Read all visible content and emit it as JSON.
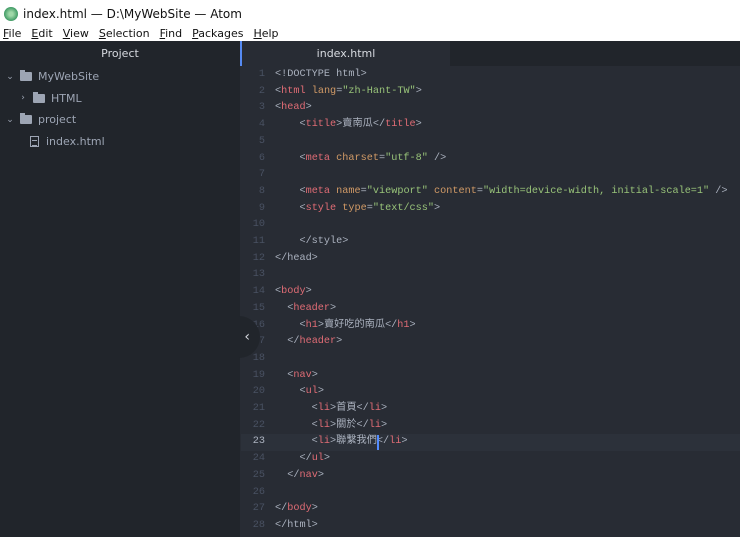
{
  "window": {
    "title": "index.html — D:\\MyWebSite — Atom",
    "icon": "atom-icon"
  },
  "menu": [
    "File",
    "Edit",
    "View",
    "Selection",
    "Find",
    "Packages",
    "Help"
  ],
  "sidebar": {
    "title": "Project",
    "items": [
      {
        "label": "MyWebSite",
        "type": "folder",
        "expanded": true,
        "depth": 0
      },
      {
        "label": "HTML",
        "type": "folder",
        "expanded": false,
        "depth": 1
      },
      {
        "label": "project",
        "type": "folder",
        "expanded": true,
        "depth": 0
      },
      {
        "label": "index.html",
        "type": "file",
        "depth": 1
      }
    ]
  },
  "tab": {
    "label": "index.html"
  },
  "colors": {
    "tag": "#e06c75",
    "attr": "#d19a66",
    "string": "#98c379",
    "text": "#abb2bf",
    "accent": "#568af2"
  },
  "editor": {
    "current_line": 23,
    "lines": [
      [
        [
          "p",
          "<!DOCTYPE html>"
        ]
      ],
      [
        [
          "p",
          "<"
        ],
        [
          "tag",
          "html"
        ],
        [
          "p",
          " "
        ],
        [
          "attr",
          "lang"
        ],
        [
          "p",
          "="
        ],
        [
          "str",
          "\"zh-Hant-TW\""
        ],
        [
          "p",
          ">"
        ]
      ],
      [
        [
          "p",
          "<"
        ],
        [
          "tag",
          "head"
        ],
        [
          "p",
          ">"
        ]
      ],
      [
        [
          "p",
          "    <"
        ],
        [
          "tag",
          "title"
        ],
        [
          "p",
          ">"
        ],
        [
          "txt",
          "賣南瓜"
        ],
        [
          "p",
          "</"
        ],
        [
          "tag",
          "title"
        ],
        [
          "p",
          ">"
        ]
      ],
      [],
      [
        [
          "p",
          "    <"
        ],
        [
          "tag",
          "meta"
        ],
        [
          "p",
          " "
        ],
        [
          "attr",
          "charset"
        ],
        [
          "p",
          "="
        ],
        [
          "str",
          "\"utf-8\""
        ],
        [
          "p",
          " />"
        ]
      ],
      [],
      [
        [
          "p",
          "    <"
        ],
        [
          "tag",
          "meta"
        ],
        [
          "p",
          " "
        ],
        [
          "attr",
          "name"
        ],
        [
          "p",
          "="
        ],
        [
          "str",
          "\"viewport\""
        ],
        [
          "p",
          " "
        ],
        [
          "attr",
          "content"
        ],
        [
          "p",
          "="
        ],
        [
          "str",
          "\"width=device-width, initial-scale=1\""
        ],
        [
          "p",
          " />"
        ]
      ],
      [
        [
          "p",
          "    <"
        ],
        [
          "tag",
          "style"
        ],
        [
          "p",
          " "
        ],
        [
          "attr",
          "type"
        ],
        [
          "p",
          "="
        ],
        [
          "str",
          "\"text/css\""
        ],
        [
          "p",
          ">"
        ]
      ],
      [],
      [
        [
          "p",
          "    </style>"
        ]
      ],
      [
        [
          "p",
          "</head>"
        ]
      ],
      [],
      [
        [
          "p",
          "<"
        ],
        [
          "tag",
          "body"
        ],
        [
          "p",
          ">"
        ]
      ],
      [
        [
          "p",
          "  <"
        ],
        [
          "tag",
          "header"
        ],
        [
          "p",
          ">"
        ]
      ],
      [
        [
          "p",
          "    <"
        ],
        [
          "tag",
          "h1"
        ],
        [
          "p",
          ">"
        ],
        [
          "txt",
          "賣好吃的南瓜"
        ],
        [
          "p",
          "</"
        ],
        [
          "tag",
          "h1"
        ],
        [
          "p",
          ">"
        ]
      ],
      [
        [
          "p",
          "  </"
        ],
        [
          "tag",
          "header"
        ],
        [
          "p",
          ">"
        ]
      ],
      [],
      [
        [
          "p",
          "  <"
        ],
        [
          "tag",
          "nav"
        ],
        [
          "p",
          ">"
        ]
      ],
      [
        [
          "p",
          "    <"
        ],
        [
          "tag",
          "ul"
        ],
        [
          "p",
          ">"
        ]
      ],
      [
        [
          "p",
          "      <"
        ],
        [
          "tag",
          "li"
        ],
        [
          "p",
          ">"
        ],
        [
          "txt",
          "首頁"
        ],
        [
          "p",
          "</"
        ],
        [
          "tag",
          "li"
        ],
        [
          "p",
          ">"
        ]
      ],
      [
        [
          "p",
          "      <"
        ],
        [
          "tag",
          "li"
        ],
        [
          "p",
          ">"
        ],
        [
          "txt",
          "關於"
        ],
        [
          "p",
          "</"
        ],
        [
          "tag",
          "li"
        ],
        [
          "p",
          ">"
        ]
      ],
      [
        [
          "p",
          "      <"
        ],
        [
          "tag",
          "li"
        ],
        [
          "p",
          ">"
        ],
        [
          "txt",
          "聯繫我們"
        ],
        [
          "p",
          "</"
        ],
        [
          "tag",
          "li"
        ],
        [
          "p",
          ">"
        ]
      ],
      [
        [
          "p",
          "    </"
        ],
        [
          "tag",
          "ul"
        ],
        [
          "p",
          ">"
        ]
      ],
      [
        [
          "p",
          "  </"
        ],
        [
          "tag",
          "nav"
        ],
        [
          "p",
          ">"
        ]
      ],
      [],
      [
        [
          "p",
          "</"
        ],
        [
          "tag",
          "body"
        ],
        [
          "p",
          ">"
        ]
      ],
      [
        [
          "p",
          "</html>"
        ]
      ]
    ]
  }
}
